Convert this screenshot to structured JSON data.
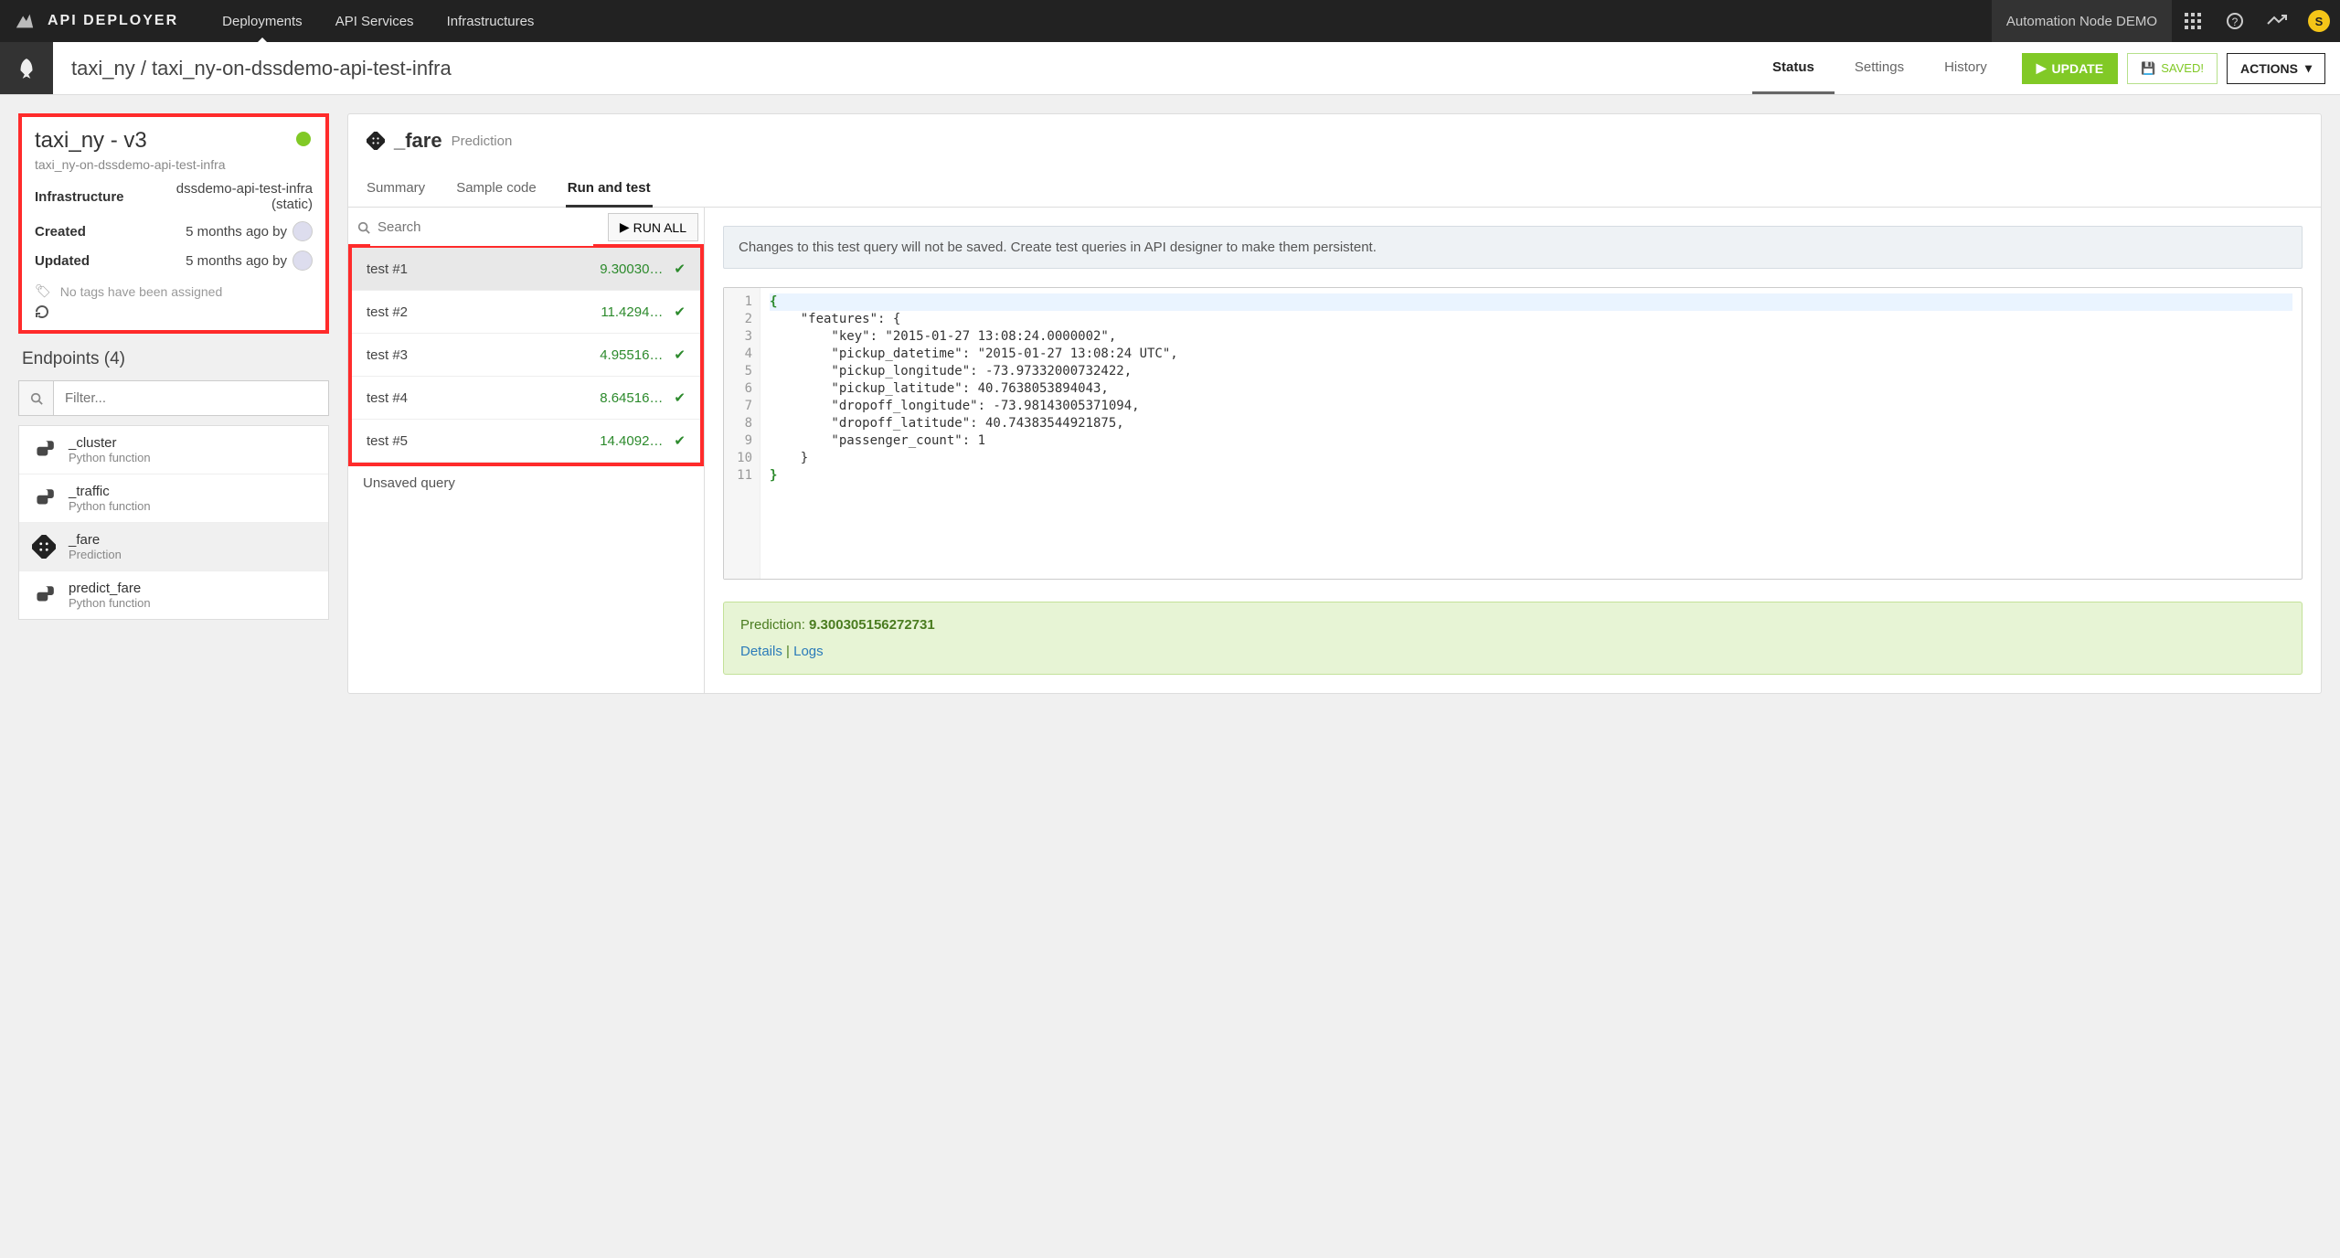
{
  "top": {
    "brand": "API DEPLOYER",
    "nav": [
      "Deployments",
      "API Services",
      "Infrastructures"
    ],
    "node_label": "Automation Node DEMO",
    "user_initial": "S"
  },
  "sub": {
    "breadcrumb": "taxi_ny / taxi_ny-on-dssdemo-api-test-infra",
    "tabs": [
      "Status",
      "Settings",
      "History"
    ],
    "update": "UPDATE",
    "saved": "SAVED!",
    "actions": "ACTIONS"
  },
  "info": {
    "title": "taxi_ny - v3",
    "sub": "taxi_ny-on-dssdemo-api-test-infra",
    "rows": [
      {
        "k": "Infrastructure",
        "v": "dssdemo-api-test-infra (static)"
      },
      {
        "k": "Created",
        "v": "5 months ago by"
      },
      {
        "k": "Updated",
        "v": "5 months ago by"
      }
    ],
    "no_tags": "No tags have been assigned"
  },
  "endpoints": {
    "title": "Endpoints (4)",
    "filter_placeholder": "Filter...",
    "items": [
      {
        "name": "_cluster",
        "type": "Python function",
        "icon": "py"
      },
      {
        "name": "_traffic",
        "type": "Python function",
        "icon": "py"
      },
      {
        "name": "_fare",
        "type": "Prediction",
        "icon": "pred"
      },
      {
        "name": "predict_fare",
        "type": "Python function",
        "icon": "py"
      }
    ]
  },
  "endpoint_view": {
    "name": "_fare",
    "type": "Prediction",
    "tabs": [
      "Summary",
      "Sample code",
      "Run and test"
    ],
    "search_placeholder": "Search",
    "runall": "RUN ALL",
    "tests": [
      {
        "name": "test #1",
        "val": "9.30030…"
      },
      {
        "name": "test #2",
        "val": "11.4294…"
      },
      {
        "name": "test #3",
        "val": "4.95516…"
      },
      {
        "name": "test #4",
        "val": "8.64516…"
      },
      {
        "name": "test #5",
        "val": "14.4092…"
      }
    ],
    "unsaved": "Unsaved query",
    "notice": "Changes to this test query will not be saved. Create test queries in API designer to make them persistent.",
    "code_json": {
      "features": {
        "key": "2015-01-27 13:08:24.0000002",
        "pickup_datetime": "2015-01-27 13:08:24 UTC",
        "pickup_longitude": -73.97332000732422,
        "pickup_latitude": 40.7638053894043,
        "dropoff_longitude": -73.98143005371094,
        "dropoff_latitude": 40.74383544921875,
        "passenger_count": 1
      }
    },
    "prediction_label": "Prediction: ",
    "prediction_value": "9.300305156272731",
    "details": "Details",
    "logs": "Logs"
  }
}
